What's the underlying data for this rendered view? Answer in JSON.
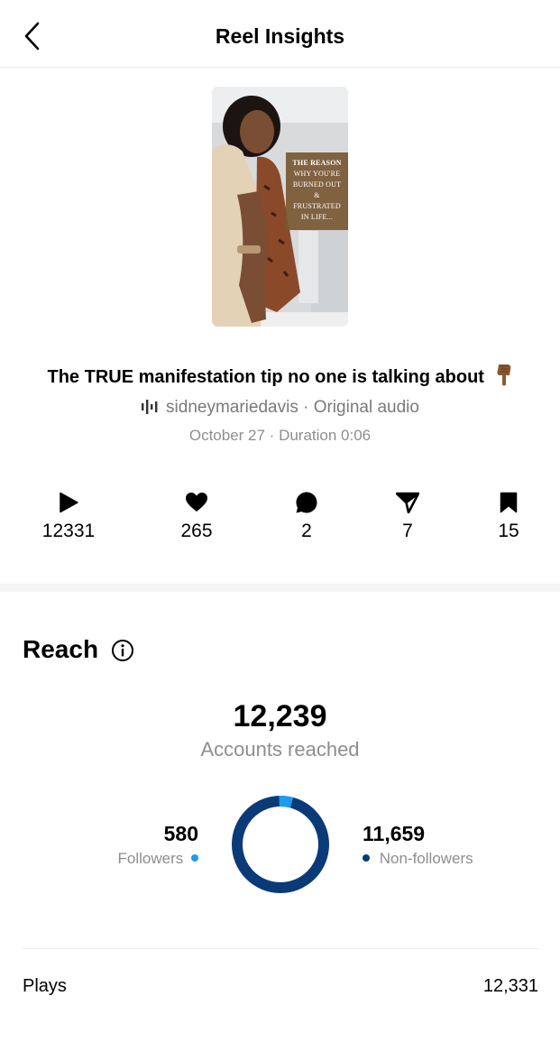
{
  "header": {
    "title": "Reel Insights",
    "back_icon": "chevron-left-icon"
  },
  "reel": {
    "thumbnail_caption": [
      "THE REASON",
      "WHY YOU'RE",
      "BURNED OUT",
      "&",
      "FRUSTRATED",
      "IN LIFE..."
    ],
    "title": "The TRUE manifestation tip no one is talking about",
    "title_emoji": "pointing-down-hand-icon",
    "audio_icon": "audio-wave-icon",
    "audio": "sidneymariedavis · Original audio",
    "meta": "October 27 · Duration 0:06"
  },
  "stats": [
    {
      "icon": "play-icon",
      "value": "12331"
    },
    {
      "icon": "heart-icon",
      "value": "265"
    },
    {
      "icon": "comment-icon",
      "value": "2"
    },
    {
      "icon": "share-icon",
      "value": "7"
    },
    {
      "icon": "bookmark-icon",
      "value": "15"
    }
  ],
  "reach": {
    "title": "Reach",
    "info_icon": "info-icon",
    "total": "12,239",
    "total_label": "Accounts reached",
    "followers_value": "580",
    "followers_label": "Followers",
    "followers_share": 0.047,
    "nonfollowers_value": "11,659",
    "nonfollowers_label": "Non-followers",
    "colors": {
      "followers": "#1e9bf0",
      "nonfollowers": "#0a3a78"
    }
  },
  "rows": [
    {
      "label": "Plays",
      "value": "12,331"
    }
  ]
}
